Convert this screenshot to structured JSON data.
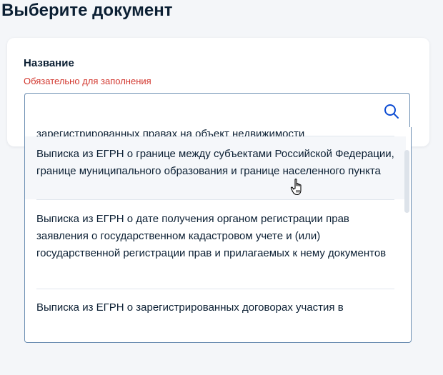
{
  "page": {
    "title": "Выберите документ"
  },
  "field": {
    "label": "Название",
    "error": "Обязательно для заполнения",
    "value": "",
    "placeholder": ""
  },
  "icons": {
    "search": "search-icon",
    "cursor": "hand-pointer-icon"
  },
  "colors": {
    "error": "#d2372e",
    "border": "#6d8fb3",
    "hover_bg": "#f5f7fa",
    "text": "#0b1f33"
  },
  "options": [
    {
      "label": "Выписка из ЕГРН о зарегистрированных правах на объект недвижимости",
      "visible_fragment": "зарегистрированных правах на объект недвижимости"
    },
    {
      "label": "Выписка из ЕГРН о границе между субъектами Российской Федерации, границе муниципального образования и границе населенного пункта"
    },
    {
      "label": "Выписка из ЕГРН о дате получения органом регистрации прав заявления о государственном кадастровом учете и (или) государственной регистрации прав и прилагаемых к нему документов"
    },
    {
      "label": "Выписка из ЕГРН о зарегистрированных договорах участия в"
    }
  ]
}
